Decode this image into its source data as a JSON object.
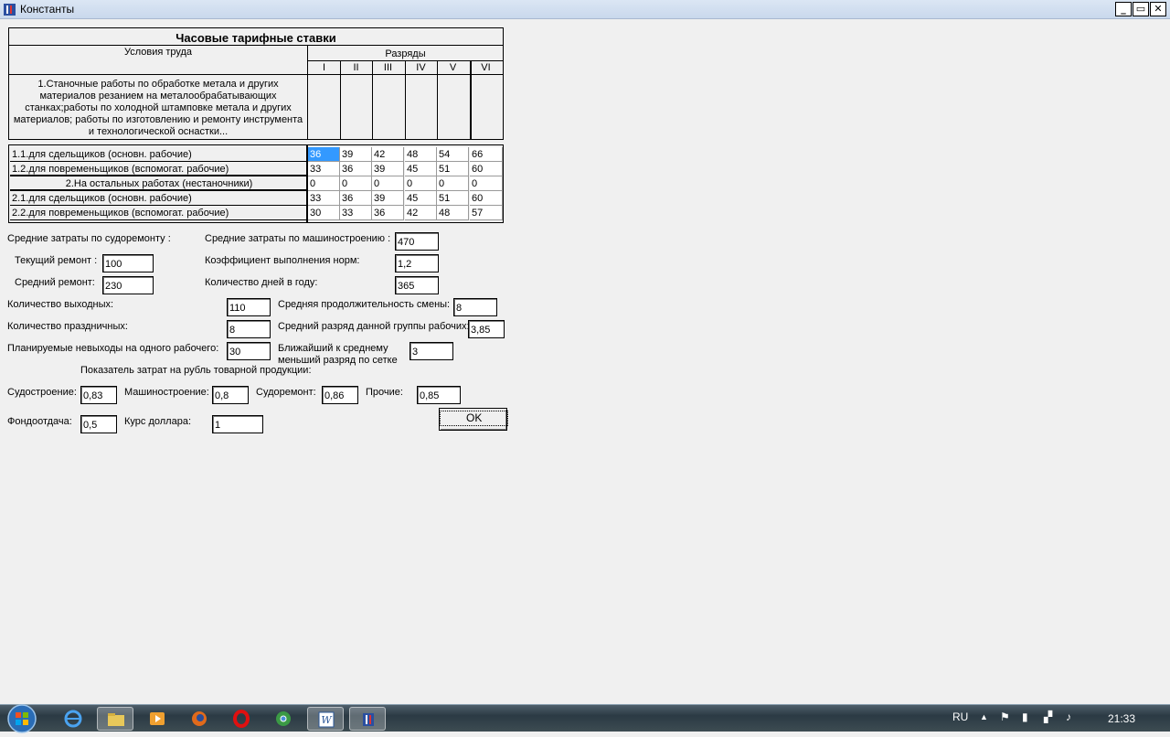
{
  "window": {
    "title": "Константы",
    "minimize_label": "_",
    "restore_label": "▭",
    "close_label": "✕"
  },
  "table": {
    "title": "Часовые тарифные ставки",
    "conditions_header": "Условия труда",
    "grades_header": "Разряды",
    "grades": [
      "I",
      "II",
      "III",
      "IV",
      "V",
      "VI"
    ],
    "section1": "1.Станочные работы по обработке метала и других материалов резанием на металообрабатывающих станках;работы по холодной штамповке метала и других материалов; работы по изготовлению и ремонту инструмента и технологической оснастки...",
    "rows": [
      {
        "label": "1.1.для сдельщиков (основн. рабочие)",
        "values": [
          "36",
          "39",
          "42",
          "48",
          "54",
          "66"
        ]
      },
      {
        "label": "1.2.для повременьщиков (вспомогат. рабочие)",
        "values": [
          "33",
          "36",
          "39",
          "45",
          "51",
          "60"
        ]
      },
      {
        "label": "2.На остальных работах (нестаночники)",
        "values": [
          "0",
          "0",
          "0",
          "0",
          "0",
          "0"
        ]
      },
      {
        "label": "2.1.для сдельщиков  (основн. рабочие)",
        "values": [
          "33",
          "36",
          "39",
          "45",
          "51",
          "60"
        ]
      },
      {
        "label": "2.2.для повременьщиков  (вспомогат. рабочие)",
        "values": [
          "30",
          "33",
          "36",
          "42",
          "48",
          "57"
        ]
      }
    ]
  },
  "form": {
    "ship_repair_costs_label": "Средние затраты  по судоремонту :",
    "current_repair_label": "Текущий ремонт :",
    "current_repair_value": "100",
    "average_repair_label": "Средний ремонт:",
    "average_repair_value": "230",
    "machine_costs_label": "Средние затраты  по машиностроению :",
    "machine_costs_value": "470",
    "norm_coef_label": "Коэффициент выполнения норм:",
    "norm_coef_value": "1,2",
    "days_per_year_label": "Количество дней в году:",
    "days_per_year_value": "365",
    "days_off_label": "Количество выходных:",
    "days_off_value": "110",
    "holidays_label": "Количество праздничных:",
    "holidays_value": "8",
    "absences_label": "Планируемые невыходы на одного рабочего:",
    "absences_value": "30",
    "shift_length_label": "Средняя продолжительность смены:",
    "shift_length_value": "8",
    "avg_grade_label": "Средний разряд данной группы рабочих:",
    "avg_grade_value": "3,85",
    "nearest_grade_label_1": "Ближайший к среднему",
    "nearest_grade_label_2": "меньший разряд по сетке",
    "nearest_grade_value": "3",
    "cost_indicator_label": "Показатель затрат на рубль товарной продукции:",
    "shipbuilding_label": "Судостроение:",
    "shipbuilding_value": "0,83",
    "machinebuilding_label": "Машиностроение:",
    "machinebuilding_value": "0,8",
    "shiprepair_label": "Судоремонт:",
    "shiprepair_value": "0,86",
    "other_label": "Прочие:",
    "other_value": "0,85",
    "capital_productivity_label": "Фондоотдача:",
    "capital_productivity_value": "0,5",
    "exchange_rate_label": "Курс доллара:",
    "exchange_rate_value": "1",
    "ok_label": "OK"
  },
  "taskbar": {
    "apps": [
      "start-orb",
      "internet-explorer-icon",
      "explorer-folder-icon",
      "media-player-icon",
      "firefox-icon",
      "opera-icon",
      "chrome-like-icon",
      "word-icon",
      "delphi-app-icon"
    ],
    "language": "RU",
    "time": "21:33"
  },
  "colors": {
    "window_bg": "#f0f0f0",
    "selection": "#3399ff",
    "taskbar": "#2b3a44"
  }
}
